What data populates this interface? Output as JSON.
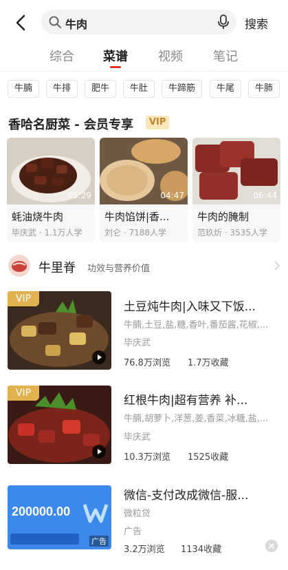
{
  "search": {
    "query": "牛肉",
    "button_label": "搜索"
  },
  "tabs": [
    {
      "label": "综合",
      "active": false
    },
    {
      "label": "菜谱",
      "active": true
    },
    {
      "label": "视频",
      "active": false
    },
    {
      "label": "笔记",
      "active": false
    }
  ],
  "chips": [
    "牛腩",
    "牛排",
    "肥牛",
    "牛肚",
    "牛蹄筋",
    "牛尾",
    "牛肺"
  ],
  "premium_section": {
    "title": "香哈名厨菜 - 会员专享",
    "badge": "VIP",
    "cards": [
      {
        "name": "蚝油烧牛肉",
        "duration": "05:29",
        "meta": "毕庆武 · 1.1万人学"
      },
      {
        "name": "牛肉馅饼|香...",
        "duration": "04:47",
        "meta": "刘仑 · 7188人学"
      },
      {
        "name": "牛肉的腌制",
        "duration": "06:44",
        "meta": "范玖炘 · 3535人学"
      }
    ]
  },
  "ingredient": {
    "name": "牛里脊",
    "subtitle": "功效与营养价值"
  },
  "recipes": [
    {
      "vip": "VIP",
      "title": "土豆炖牛肉|入味又下饭...",
      "ingredients": "牛腩,土豆,盐,糖,香叶,番茄酱,花椒,...",
      "author": "毕庆武",
      "views": "76.8万浏览",
      "favorites": "1.7万收藏"
    },
    {
      "vip": "VIP",
      "title": "红根牛肉|超有营养 补...",
      "ingredients": "牛腩,胡萝卜,洋葱,姜,香菜,冰糖,盐,...",
      "author": "毕庆武",
      "views": "10.3万浏览",
      "favorites": "1525收藏"
    },
    {
      "title": "微信-支付改成微信-服...",
      "ingredients": "微粒贷",
      "author": "广告",
      "views": "3.2万浏览",
      "favorites": "1134收藏",
      "ad_amount": "200000.00",
      "ad_label": "广告"
    }
  ],
  "colors": {
    "accent": "#e5322d",
    "vip_gold": "#e2b24f",
    "vip_bg": "#fbe6bc"
  },
  "icons": [
    "back-arrow-icon",
    "search-icon",
    "microphone-icon",
    "play-icon",
    "chevron-right-icon",
    "close-icon"
  ]
}
